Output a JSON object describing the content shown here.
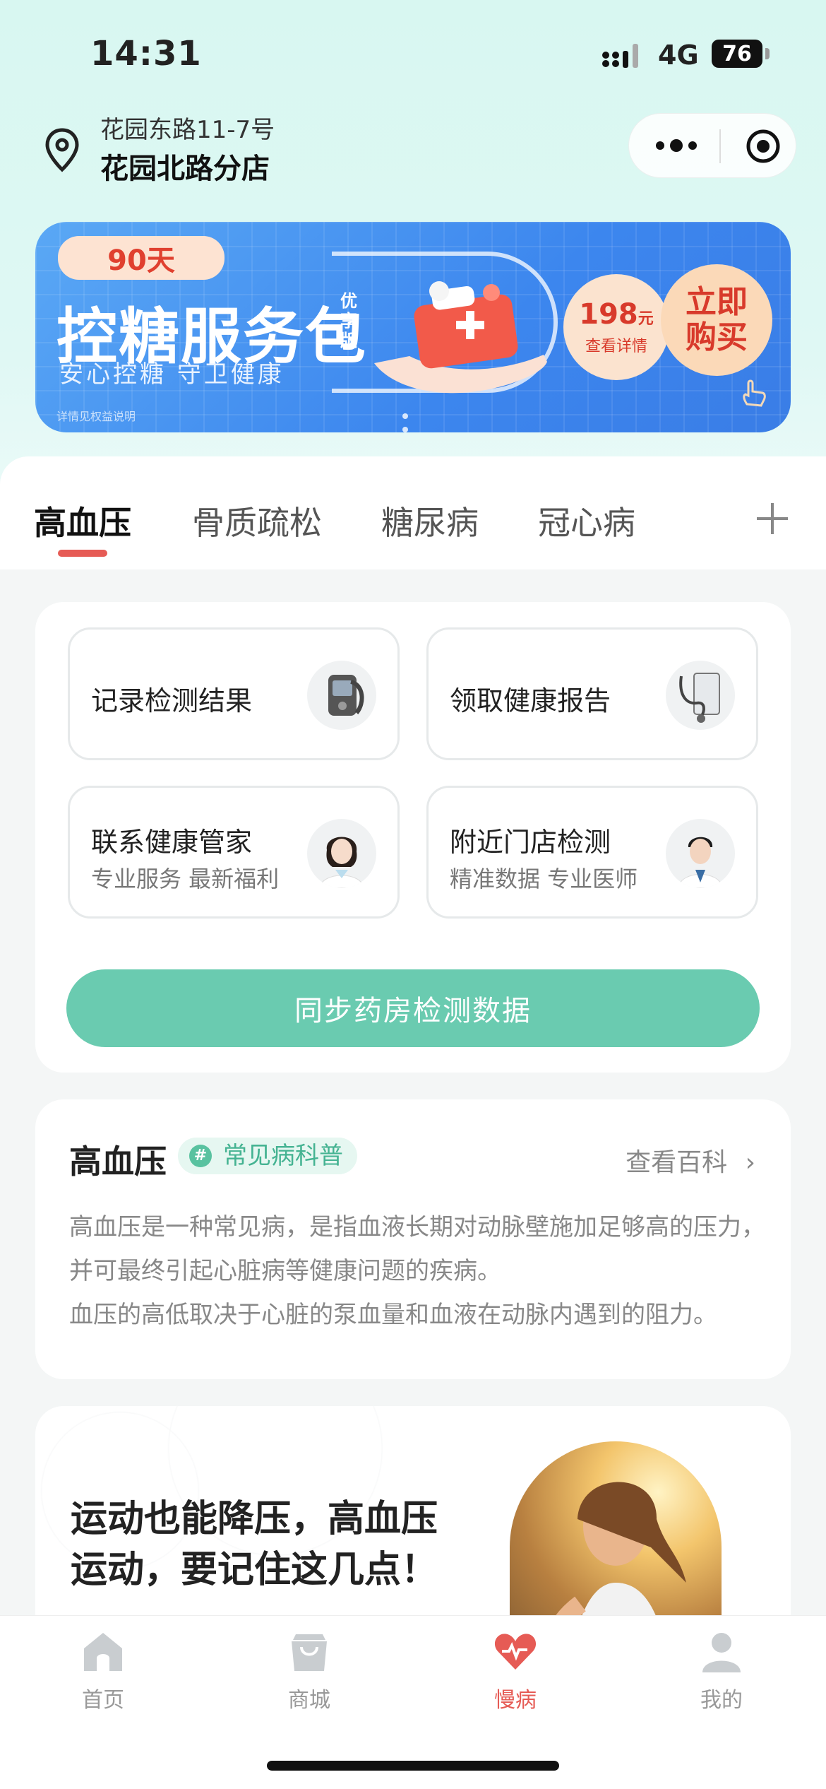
{
  "status_bar": {
    "time": "14:31",
    "network": "4G",
    "battery": "76"
  },
  "location": {
    "address": "花园东路11-7号",
    "store": "花园北路分店"
  },
  "banner": {
    "days_tag": "90天",
    "title": "控糖服务包",
    "title_mark": "优享版",
    "subtitle": "安心控糖 守卫健康",
    "footnote": "详情见权益说明",
    "price": "198",
    "price_unit": "元",
    "price_detail": "查看详情",
    "buy_label": "立即购买"
  },
  "tabs": [
    {
      "label": "高血压",
      "active": true
    },
    {
      "label": "骨质疏松",
      "active": false
    },
    {
      "label": "糖尿病",
      "active": false
    },
    {
      "label": "冠心病",
      "active": false
    }
  ],
  "actions": {
    "record": {
      "title": "记录检测结果"
    },
    "report": {
      "title": "领取健康报告"
    },
    "manager": {
      "title": "联系健康管家",
      "subtitle": "专业服务 最新福利"
    },
    "store_test": {
      "title": "附近门店检测",
      "subtitle": "精准数据 专业医师"
    },
    "sync_button": "同步药房检测数据"
  },
  "encyclopedia": {
    "title": "高血压",
    "badge": "常见病科普",
    "badge_icon": "#",
    "link": "查看百科",
    "link_arrow": "›",
    "text1": "高血压是一种常见病，是指血液长期对动脉壁施加足够高的压力，并可最终引起心脏病等健康问题的疾病。",
    "text2": "血压的高低取决于心脏的泵血量和血液在动脉内遇到的阻力。"
  },
  "article": {
    "title_line1": "运动也能降压，高血压",
    "title_line2": "运动，要记住这几点！"
  },
  "tabbar": [
    {
      "label": "首页",
      "icon": "home-icon",
      "active": false
    },
    {
      "label": "商城",
      "icon": "shop-bag-icon",
      "active": false
    },
    {
      "label": "慢病",
      "icon": "heart-icon",
      "active": true
    },
    {
      "label": "我的",
      "icon": "profile-icon",
      "active": false
    }
  ],
  "colors": {
    "accent_red": "#e65b55",
    "mint": "#6acbb0",
    "banner_blue": "#3c86ee"
  }
}
